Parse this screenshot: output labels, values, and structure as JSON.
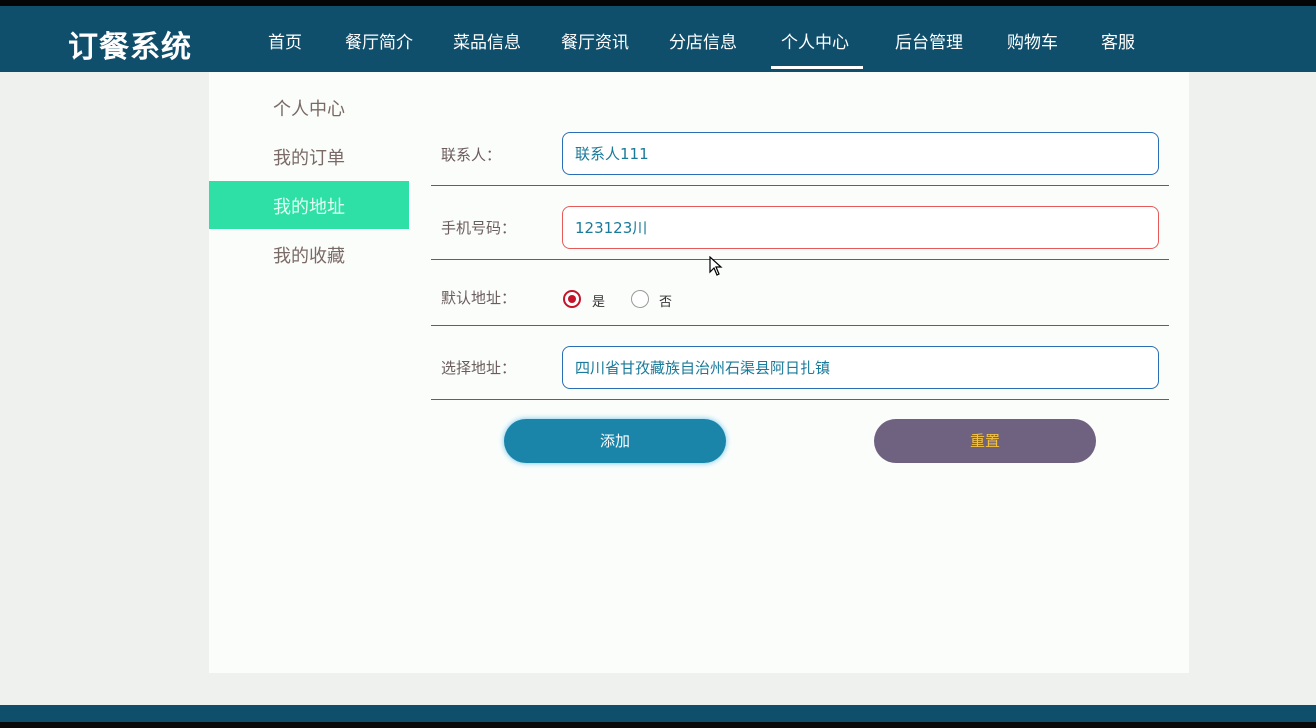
{
  "brand": "订餐系统",
  "nav": {
    "items": [
      "首页",
      "餐厅简介",
      "菜品信息",
      "餐厅资讯",
      "分店信息",
      "个人中心",
      "后台管理",
      "购物车",
      "客服"
    ],
    "active": "个人中心"
  },
  "sidebar": {
    "items": [
      "个人中心",
      "我的订单",
      "我的地址",
      "我的收藏"
    ],
    "active": "我的地址"
  },
  "form": {
    "contact": {
      "label": "联系人：",
      "value": "联系人111"
    },
    "phone": {
      "label": "手机号码：",
      "value": "123123川"
    },
    "default_address": {
      "label": "默认地址：",
      "options": [
        "是",
        "否"
      ],
      "selected": "是"
    },
    "address": {
      "label": "选择地址：",
      "value": "四川省甘孜藏族自治州石渠县阿日扎镇"
    }
  },
  "buttons": {
    "add": "添加",
    "reset": "重置"
  },
  "colors": {
    "navbar": "#0f4f6c",
    "sidebar_active": "#2fe0a6",
    "add_button": "#1a85a8",
    "reset_button": "#6e6280"
  }
}
